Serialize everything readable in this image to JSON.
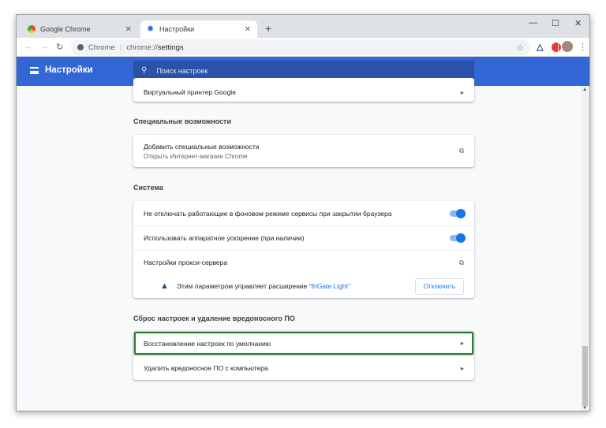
{
  "tabs": [
    {
      "label": "Google Chrome",
      "icon": "chrome-icon",
      "active": false
    },
    {
      "label": "Настройки",
      "icon": "gear-icon",
      "active": true
    }
  ],
  "address": {
    "site": "Chrome",
    "url_prefix": "chrome://",
    "url_path": "settings"
  },
  "header": {
    "title": "Настройки",
    "search_placeholder": "Поиск настроек"
  },
  "colors": {
    "header": "#3367d6",
    "accent": "#1a73e8",
    "highlight": "#2e7d32"
  },
  "sections": {
    "top_item": "Виртуальный принтер Google",
    "accessibility": {
      "title": "Специальные возможности",
      "item": "Добавить специальные возможности",
      "sub": "Открыть Интернет-магазин Chrome"
    },
    "system": {
      "title": "Система",
      "background": "Не отключать работающие в фоновом режиме сервисы при закрытии браузера",
      "background_on": true,
      "hw": "Использовать аппаратное ускорение (при наличии)",
      "hw_on": true,
      "proxy": "Настройки прокси-сервера",
      "ext_text": "Этим параметром управляет расширение ",
      "ext_name": "\"friGate Light\"",
      "disable": "Отключить"
    },
    "reset": {
      "title": "Сброс настроек и удаление вредоносного ПО",
      "restore": "Восстановление настроек по умолчанию",
      "cleanup": "Удалить вредоносное ПО с компьютера"
    }
  }
}
